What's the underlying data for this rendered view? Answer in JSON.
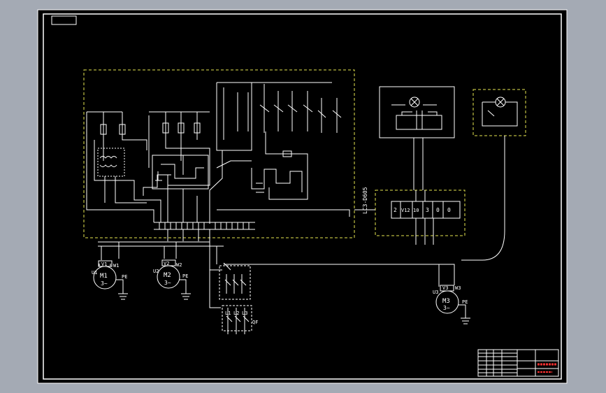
{
  "colors": {
    "window_bg": "#a4aab4",
    "sheet_bg": "#000000",
    "line": "#ffffff",
    "dashed_frame": "#e6e650",
    "title_red": "#ff3030"
  },
  "labels": {
    "panel_model": "LC3-D605",
    "motor1_name": "M1",
    "motor1_phase": "3~",
    "motor1_u": "U1",
    "motor1_v": "V1",
    "motor1_w": "W1",
    "motor2_name": "M2",
    "motor2_phase": "3~",
    "motor2_u": "U2",
    "motor2_v": "V2",
    "motor2_w": "W2",
    "motor3_name": "M3",
    "motor3_phase": "3~",
    "motor3_u": "U3",
    "motor3_v": "V3",
    "motor3_w": "W3",
    "pe": "PE",
    "qf": "QF",
    "l1": "L1",
    "l2": "L2",
    "l3": "L3",
    "terminals_right": [
      "2",
      "V12",
      "10",
      "3",
      "0",
      "0"
    ]
  }
}
